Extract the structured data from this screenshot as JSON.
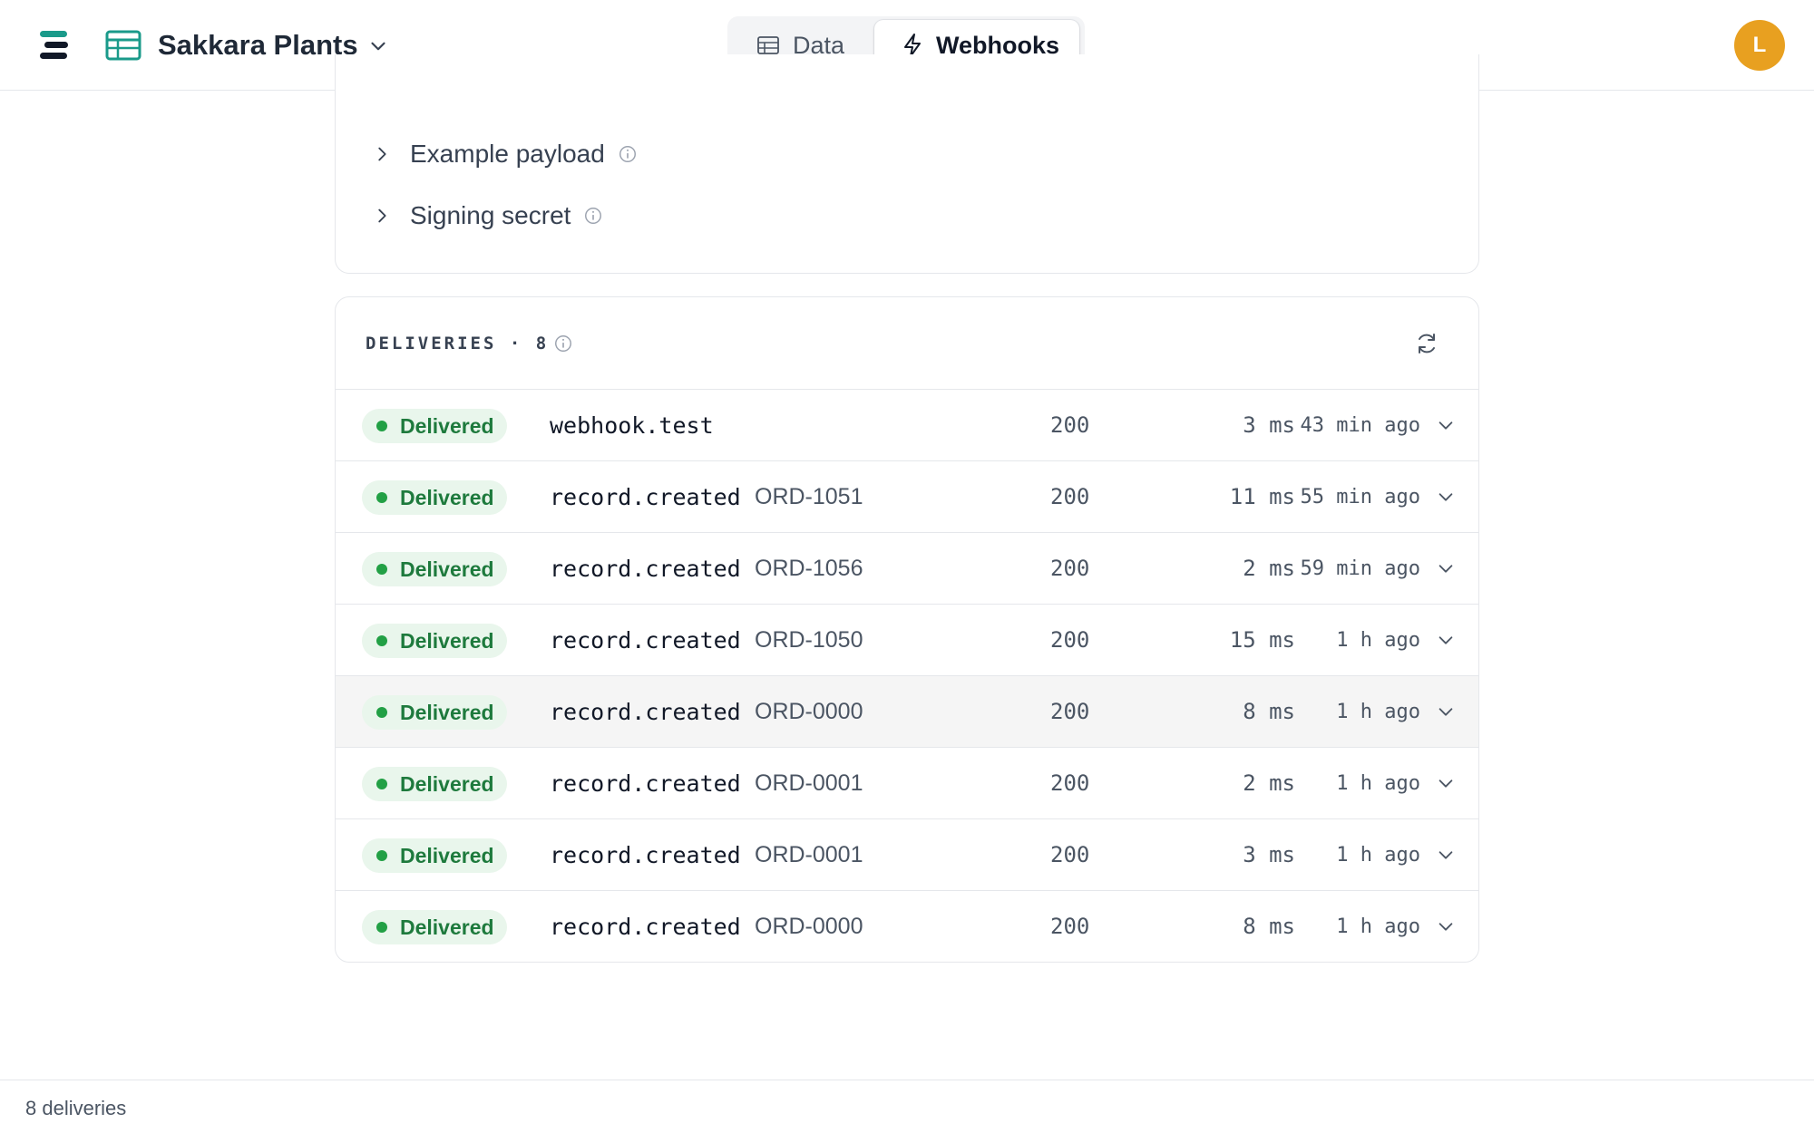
{
  "header": {
    "app_title": "Sakkara Plants",
    "tabs": [
      {
        "label": "Data",
        "icon": "table-icon",
        "active": false
      },
      {
        "label": "Webhooks",
        "icon": "lightning-icon",
        "active": true
      }
    ],
    "avatar_initial": "L"
  },
  "settings": {
    "example_payload_label": "Example payload",
    "signing_secret_label": "Signing secret"
  },
  "deliveries": {
    "title": "DELIVERIES · 8",
    "rows": [
      {
        "status_label": "Delivered",
        "event": "webhook.test",
        "ref": "",
        "code": "200",
        "duration": "3 ms",
        "ago": "43 min ago"
      },
      {
        "status_label": "Delivered",
        "event": "record.created",
        "ref": "ORD-1051",
        "code": "200",
        "duration": "11 ms",
        "ago": "55 min ago"
      },
      {
        "status_label": "Delivered",
        "event": "record.created",
        "ref": "ORD-1056",
        "code": "200",
        "duration": "2 ms",
        "ago": "59 min ago"
      },
      {
        "status_label": "Delivered",
        "event": "record.created",
        "ref": "ORD-1050",
        "code": "200",
        "duration": "15 ms",
        "ago": "1 h ago"
      },
      {
        "status_label": "Delivered",
        "event": "record.created",
        "ref": "ORD-0000",
        "code": "200",
        "duration": "8 ms",
        "ago": "1 h ago"
      },
      {
        "status_label": "Delivered",
        "event": "record.created",
        "ref": "ORD-0001",
        "code": "200",
        "duration": "2 ms",
        "ago": "1 h ago"
      },
      {
        "status_label": "Delivered",
        "event": "record.created",
        "ref": "ORD-0001",
        "code": "200",
        "duration": "3 ms",
        "ago": "1 h ago"
      },
      {
        "status_label": "Delivered",
        "event": "record.created",
        "ref": "ORD-0000",
        "code": "200",
        "duration": "8 ms",
        "ago": "1 h ago"
      }
    ]
  },
  "footer": {
    "summary": "8 deliveries"
  },
  "colors": {
    "brand_teal": "#1a9a8a",
    "delivered_green": "#1e7a3d",
    "delivered_bg": "#e9f6ec",
    "avatar": "#e8a020"
  }
}
